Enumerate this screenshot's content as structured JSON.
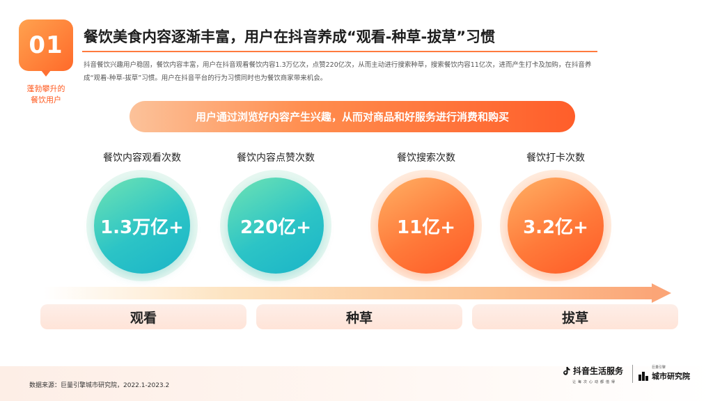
{
  "badge": {
    "number": "01",
    "caption_line1": "蓬勃攀升的",
    "caption_line2": "餐饮用户"
  },
  "headline": "餐饮美食内容逐渐丰富，用户在抖音养成“观看-种草-拔草”习惯",
  "intro": "抖音餐饮兴趣用户稳固，餐饮内容丰富，用户在抖音观看餐饮内容1.3万亿次，点赞220亿次，从而主动进行搜索种草，搜索餐饮内容11亿次，进而产生打卡及加购，在抖音养成“观看-种草-拔草”习惯。用户在抖音平台的行为习惯同时也为餐饮商家带来机会。",
  "banner": "用户通过浏览好内容产生兴趣，从而对商品和好服务进行消费和购买",
  "metrics": [
    {
      "label": "餐饮内容观看次数",
      "value": "1.3万亿+",
      "tone": "teal"
    },
    {
      "label": "餐饮内容点赞次数",
      "value": "220亿+",
      "tone": "teal"
    },
    {
      "label": "餐饮搜索次数",
      "value": "11亿+",
      "tone": "orange"
    },
    {
      "label": "餐饮打卡次数",
      "value": "3.2亿+",
      "tone": "orange"
    }
  ],
  "stages": [
    "观看",
    "种草",
    "拔草"
  ],
  "source": "数据来源：巨量引擎城市研究院，2022.1-2023.2",
  "brands": {
    "douyin_name": "抖音生活服务",
    "douyin_slogan": "让每次心动都值得",
    "research_small": "巨量引擎",
    "research_name": "城市研究院"
  },
  "colors": {
    "accent_orange": "#ff6a2a",
    "teal": "#2cc4c6"
  }
}
